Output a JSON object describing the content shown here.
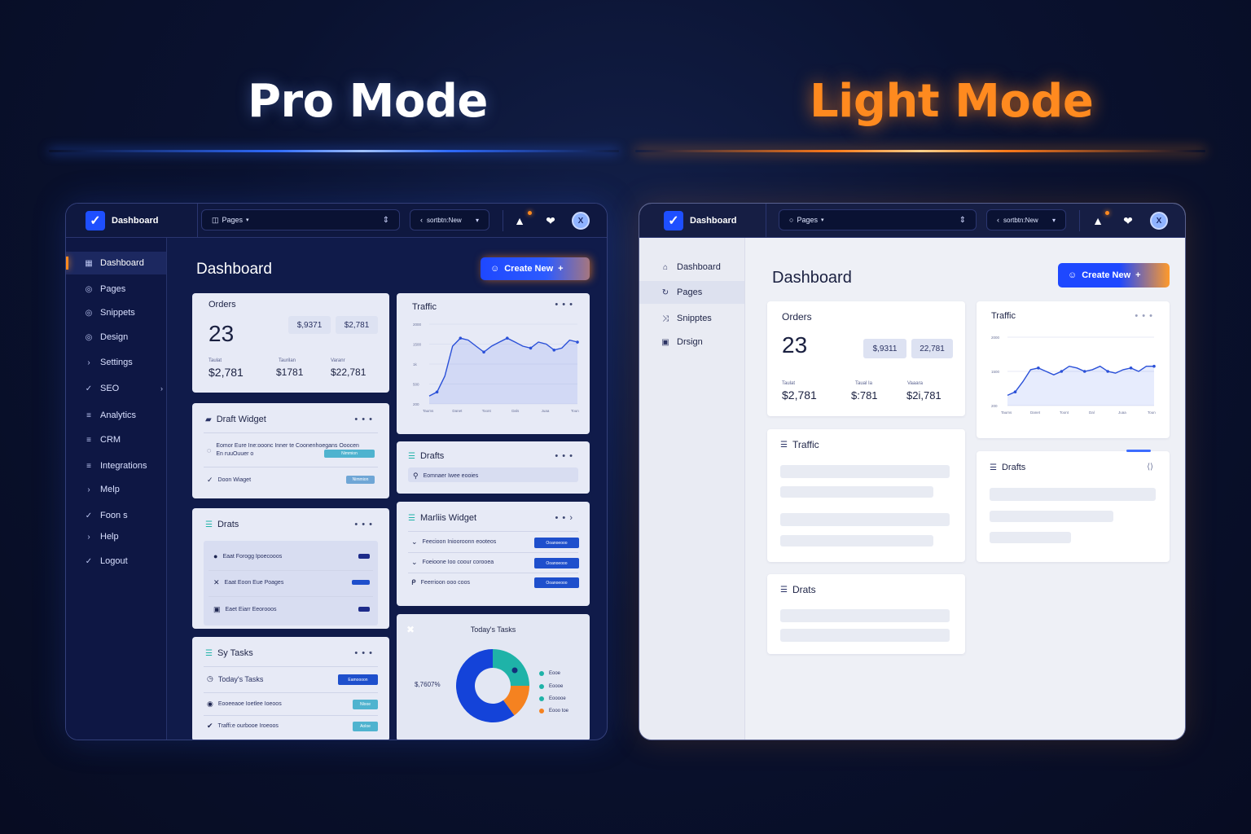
{
  "hero": {
    "pro_title": "Pro Mode",
    "light_title": "Light Mode"
  },
  "colors": {
    "accent_blue": "#1e48ff",
    "accent_orange": "#ff8a1f",
    "teal": "#1fb3a8",
    "donut_blue": "#1443d9",
    "donut_orange": "#f58220"
  },
  "pro": {
    "topbar": {
      "brand": "Dashboard",
      "pages_select": "Pages",
      "new_select": "sortbtn:New"
    },
    "sidebar": [
      {
        "icon": "grid-icon",
        "glyph": "▦",
        "label": "Dashboard",
        "active": true
      },
      {
        "icon": "circle-icon",
        "glyph": "◎",
        "label": "Pages"
      },
      {
        "icon": "circle-icon",
        "glyph": "◎",
        "label": "Snippets"
      },
      {
        "icon": "circle-icon",
        "glyph": "◎",
        "label": "Design"
      },
      {
        "icon": "chevron-right-icon",
        "glyph": "›",
        "label": "Settings"
      },
      {
        "icon": "check-icon",
        "glyph": "✓",
        "label": "SEO"
      },
      {
        "icon": "list-icon",
        "glyph": "≡",
        "label": "Analytics"
      },
      {
        "icon": "list-icon",
        "glyph": "≡",
        "label": "CRM"
      },
      {
        "icon": "list-icon",
        "glyph": "≡",
        "label": "Integrations"
      },
      {
        "icon": "chevron-right-icon",
        "glyph": "›",
        "label": "Melp"
      },
      {
        "icon": "check-icon",
        "glyph": "✓",
        "label": "Foon s"
      },
      {
        "icon": "chevron-right-icon",
        "glyph": "›",
        "label": "Help"
      },
      {
        "icon": "check-icon",
        "glyph": "✓",
        "label": "Logout"
      }
    ],
    "page_title": "Dashboard",
    "create_button": "Create New",
    "orders": {
      "title": "Orders",
      "count": "23",
      "pill_1": "$,9371",
      "pill_2": "$2,781",
      "stats": [
        {
          "label": "Taulat",
          "value": "$2,781"
        },
        {
          "label": "Taurilan",
          "value": "$1781"
        },
        {
          "label": "Varanr",
          "value": "$22,781"
        }
      ]
    },
    "traffic": {
      "title": "Traffic",
      "y_ticks": [
        "2000",
        "1500",
        "1k",
        "500",
        "200"
      ],
      "x_ticks": [
        "Taums",
        "Danet",
        "Toont",
        "Dals",
        "Juaa",
        "Toun"
      ]
    },
    "draft_widget": {
      "title": "Draft Widget",
      "row_1": "Eomor Eure Ine:ooonc Inner te Coonenhoegans Ooocen En ruuOuuer o",
      "row_1_tag": "Nimmion",
      "row_2": "Doon Wiaget",
      "row_2_tag": "Nimmion"
    },
    "drafts_small": {
      "title": "Drafts",
      "row": "Eomnaer Iwee eooies"
    },
    "drats": {
      "title": "Drats",
      "rows": [
        {
          "icon": "globe-icon",
          "glyph": "●",
          "text": "Eaat Forogg Ipoecooos"
        },
        {
          "icon": "close-icon",
          "glyph": "✕",
          "text": "Eaat Eoon Eue Poages"
        },
        {
          "icon": "image-icon",
          "glyph": "▣",
          "text": "Eaet Eiarr Eeorooos"
        }
      ]
    },
    "marlins": {
      "title": "Marliis Widget",
      "rows": [
        {
          "text": "Feecioon Iniooroonn eooteos",
          "tag": "Ooanoeooo"
        },
        {
          "text": "Foeioone Ioo coour corooea",
          "tag": "Ooanoeooo"
        },
        {
          "text": "Feerrioon ooo coos",
          "tag": "Ooanoeooo"
        }
      ]
    },
    "tasks": {
      "title": "Sy Tasks",
      "rows": [
        {
          "icon": "clock-icon",
          "glyph": "◷",
          "text": "Today's Tasks",
          "tag": "Eamoooon",
          "tag_color": "blue"
        },
        {
          "icon": "record-icon",
          "glyph": "◉",
          "text": "Eooeeaoe Ioetlee Ioeoos",
          "tag": "Nlooe",
          "tag_color": "teal"
        },
        {
          "icon": "check-icon",
          "glyph": "✔",
          "text": "Traffi:e ourbooe Iroeoos",
          "tag": "Aoloe",
          "tag_color": "teal"
        }
      ]
    },
    "today": {
      "title": "Today's Tasks",
      "total": "$,7607%",
      "legend": [
        {
          "label": "Eooe",
          "color": "#1fb3a8"
        },
        {
          "label": "Eoooe",
          "color": "#1fb3a8"
        },
        {
          "label": "Eooooe",
          "color": "#1fb3a8"
        },
        {
          "label": "Eooo toe",
          "color": "#f58220"
        }
      ]
    }
  },
  "light": {
    "topbar": {
      "brand": "Dashboard",
      "pages_select": "Pages",
      "new_select": "sortbtn:New"
    },
    "sidebar": [
      {
        "icon": "home-icon",
        "glyph": "⌂",
        "label": "Dashboard"
      },
      {
        "icon": "refresh-icon",
        "glyph": "↻",
        "label": "Pages",
        "active": true
      },
      {
        "icon": "shuffle-icon",
        "glyph": "⤨",
        "label": "Snipptes"
      },
      {
        "icon": "design-icon",
        "glyph": "▣",
        "label": "Drsign"
      }
    ],
    "page_title": "Dashboard",
    "create_button": "Create New",
    "orders": {
      "title": "Orders",
      "count": "23",
      "pill_1": "$,9311",
      "pill_2": "22,781",
      "stats": [
        {
          "label": "Taulat",
          "value": "$2,781"
        },
        {
          "label": "Taual Ia",
          "value": "$:781"
        },
        {
          "label": "Vaaara",
          "value": "$2i,781"
        }
      ]
    },
    "traffic_chart": {
      "title": "Traffic",
      "y_ticks": [
        "2000",
        "1500",
        "200"
      ],
      "x_ticks": [
        "Taums",
        "Danet",
        "Toont",
        "Dal",
        "Juaa",
        "Toun"
      ]
    },
    "traffic_list": {
      "title": "Traffic"
    },
    "drafts": {
      "title": "Drafts"
    },
    "drats": {
      "title": "Drats"
    }
  },
  "chart_data": [
    {
      "type": "line",
      "title": "Traffic",
      "x": [
        1,
        2,
        3,
        4,
        5,
        6,
        7,
        8,
        9,
        10,
        11,
        12,
        13,
        14,
        15,
        16,
        17,
        18,
        19,
        20
      ],
      "series": [
        {
          "values": [
            200,
            300,
            700,
            1450,
            1650,
            1600,
            1450,
            1300,
            1450,
            1550,
            1650,
            1550,
            1450,
            1400,
            1550,
            1500,
            1350,
            1400,
            1600,
            1550
          ]
        }
      ],
      "ylim": [
        0,
        2000
      ],
      "grid": true
    },
    {
      "type": "line",
      "title": "Traffic",
      "x": [
        1,
        2,
        3,
        4,
        5,
        6,
        7,
        8,
        9,
        10,
        11,
        12,
        13,
        14,
        15,
        16,
        17,
        18,
        19,
        20
      ],
      "series": [
        {
          "values": [
            300,
            400,
            700,
            1050,
            1100,
            1000,
            900,
            1000,
            1150,
            1100,
            1000,
            1050,
            1150,
            1000,
            950,
            1050,
            1100,
            1000,
            1150,
            1150
          ]
        }
      ],
      "ylim": [
        0,
        2000
      ],
      "grid": true
    },
    {
      "type": "pie",
      "title": "Today's Tasks",
      "categories": [
        "Eooe",
        "Eooooe",
        "Eooo toe"
      ],
      "values": [
        25,
        60,
        15
      ]
    }
  ]
}
